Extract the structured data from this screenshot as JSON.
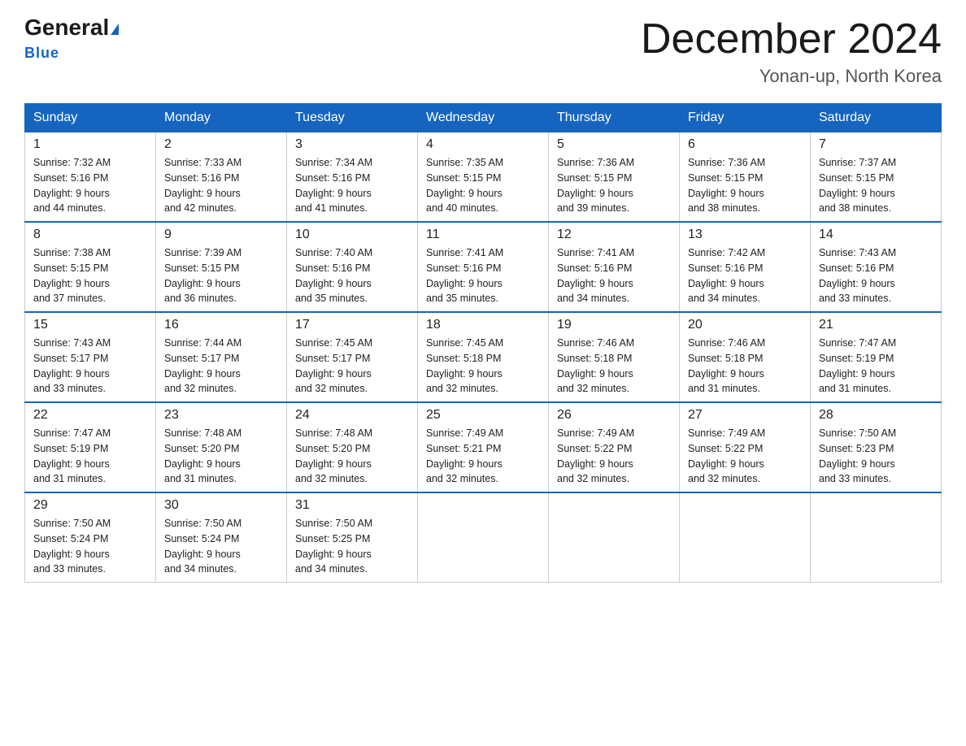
{
  "logo": {
    "general": "General",
    "blue": "Blue"
  },
  "title": "December 2024",
  "location": "Yonan-up, North Korea",
  "days_of_week": [
    "Sunday",
    "Monday",
    "Tuesday",
    "Wednesday",
    "Thursday",
    "Friday",
    "Saturday"
  ],
  "weeks": [
    [
      {
        "day": "1",
        "sunrise": "7:32 AM",
        "sunset": "5:16 PM",
        "daylight": "9 hours and 44 minutes."
      },
      {
        "day": "2",
        "sunrise": "7:33 AM",
        "sunset": "5:16 PM",
        "daylight": "9 hours and 42 minutes."
      },
      {
        "day": "3",
        "sunrise": "7:34 AM",
        "sunset": "5:16 PM",
        "daylight": "9 hours and 41 minutes."
      },
      {
        "day": "4",
        "sunrise": "7:35 AM",
        "sunset": "5:15 PM",
        "daylight": "9 hours and 40 minutes."
      },
      {
        "day": "5",
        "sunrise": "7:36 AM",
        "sunset": "5:15 PM",
        "daylight": "9 hours and 39 minutes."
      },
      {
        "day": "6",
        "sunrise": "7:36 AM",
        "sunset": "5:15 PM",
        "daylight": "9 hours and 38 minutes."
      },
      {
        "day": "7",
        "sunrise": "7:37 AM",
        "sunset": "5:15 PM",
        "daylight": "9 hours and 38 minutes."
      }
    ],
    [
      {
        "day": "8",
        "sunrise": "7:38 AM",
        "sunset": "5:15 PM",
        "daylight": "9 hours and 37 minutes."
      },
      {
        "day": "9",
        "sunrise": "7:39 AM",
        "sunset": "5:15 PM",
        "daylight": "9 hours and 36 minutes."
      },
      {
        "day": "10",
        "sunrise": "7:40 AM",
        "sunset": "5:16 PM",
        "daylight": "9 hours and 35 minutes."
      },
      {
        "day": "11",
        "sunrise": "7:41 AM",
        "sunset": "5:16 PM",
        "daylight": "9 hours and 35 minutes."
      },
      {
        "day": "12",
        "sunrise": "7:41 AM",
        "sunset": "5:16 PM",
        "daylight": "9 hours and 34 minutes."
      },
      {
        "day": "13",
        "sunrise": "7:42 AM",
        "sunset": "5:16 PM",
        "daylight": "9 hours and 34 minutes."
      },
      {
        "day": "14",
        "sunrise": "7:43 AM",
        "sunset": "5:16 PM",
        "daylight": "9 hours and 33 minutes."
      }
    ],
    [
      {
        "day": "15",
        "sunrise": "7:43 AM",
        "sunset": "5:17 PM",
        "daylight": "9 hours and 33 minutes."
      },
      {
        "day": "16",
        "sunrise": "7:44 AM",
        "sunset": "5:17 PM",
        "daylight": "9 hours and 32 minutes."
      },
      {
        "day": "17",
        "sunrise": "7:45 AM",
        "sunset": "5:17 PM",
        "daylight": "9 hours and 32 minutes."
      },
      {
        "day": "18",
        "sunrise": "7:45 AM",
        "sunset": "5:18 PM",
        "daylight": "9 hours and 32 minutes."
      },
      {
        "day": "19",
        "sunrise": "7:46 AM",
        "sunset": "5:18 PM",
        "daylight": "9 hours and 32 minutes."
      },
      {
        "day": "20",
        "sunrise": "7:46 AM",
        "sunset": "5:18 PM",
        "daylight": "9 hours and 31 minutes."
      },
      {
        "day": "21",
        "sunrise": "7:47 AM",
        "sunset": "5:19 PM",
        "daylight": "9 hours and 31 minutes."
      }
    ],
    [
      {
        "day": "22",
        "sunrise": "7:47 AM",
        "sunset": "5:19 PM",
        "daylight": "9 hours and 31 minutes."
      },
      {
        "day": "23",
        "sunrise": "7:48 AM",
        "sunset": "5:20 PM",
        "daylight": "9 hours and 31 minutes."
      },
      {
        "day": "24",
        "sunrise": "7:48 AM",
        "sunset": "5:20 PM",
        "daylight": "9 hours and 32 minutes."
      },
      {
        "day": "25",
        "sunrise": "7:49 AM",
        "sunset": "5:21 PM",
        "daylight": "9 hours and 32 minutes."
      },
      {
        "day": "26",
        "sunrise": "7:49 AM",
        "sunset": "5:22 PM",
        "daylight": "9 hours and 32 minutes."
      },
      {
        "day": "27",
        "sunrise": "7:49 AM",
        "sunset": "5:22 PM",
        "daylight": "9 hours and 32 minutes."
      },
      {
        "day": "28",
        "sunrise": "7:50 AM",
        "sunset": "5:23 PM",
        "daylight": "9 hours and 33 minutes."
      }
    ],
    [
      {
        "day": "29",
        "sunrise": "7:50 AM",
        "sunset": "5:24 PM",
        "daylight": "9 hours and 33 minutes."
      },
      {
        "day": "30",
        "sunrise": "7:50 AM",
        "sunset": "5:24 PM",
        "daylight": "9 hours and 34 minutes."
      },
      {
        "day": "31",
        "sunrise": "7:50 AM",
        "sunset": "5:25 PM",
        "daylight": "9 hours and 34 minutes."
      },
      null,
      null,
      null,
      null
    ]
  ],
  "labels": {
    "sunrise": "Sunrise:",
    "sunset": "Sunset:",
    "daylight": "Daylight:"
  }
}
